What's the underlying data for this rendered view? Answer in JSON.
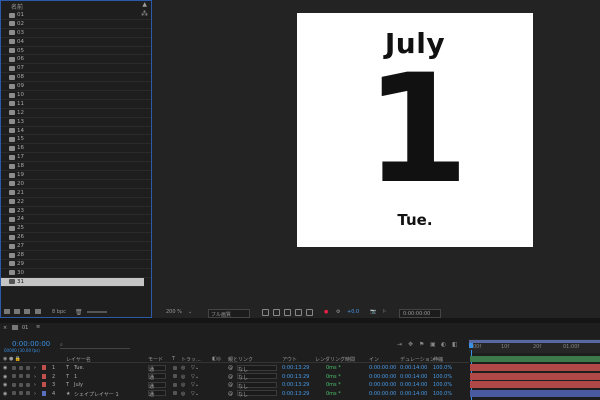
{
  "project": {
    "header_name": "名前",
    "sort_icon": "triangle-up-icon",
    "flow_icon": "flowchart-icon",
    "items": [
      "01",
      "02",
      "03",
      "04",
      "05",
      "06",
      "07",
      "08",
      "09",
      "10",
      "11",
      "12",
      "13",
      "14",
      "15",
      "16",
      "17",
      "18",
      "19",
      "20",
      "21",
      "22",
      "23",
      "24",
      "25",
      "26",
      "27",
      "28",
      "29",
      "30",
      "31"
    ],
    "selected_item": "31",
    "bpc_label": "8 bpc"
  },
  "composition": {
    "month": "July",
    "day": "1",
    "weekday": "Tue."
  },
  "viewer_bar": {
    "zoom": "200 %",
    "resolution": "フル画質",
    "exposure": "+0.0",
    "timecode": "0:00:00:00"
  },
  "timeline": {
    "tab_name": "01",
    "current_time": "0:00:00:00",
    "sub_time": "00000 (30.00 fps)",
    "search_placeholder": "",
    "ruler_ticks": [
      "00f",
      "10f",
      "20f",
      "01:00f"
    ],
    "columns": {
      "layer_name": "レイヤー名",
      "mode": "モード",
      "t": "T",
      "track": "トラッ...",
      "parent": "親とリンク",
      "out": "アウト",
      "render_time": "レンダリング時間",
      "in": "イン",
      "duration": "デュレーション",
      "stretch": "伸縮"
    },
    "layers": [
      {
        "num": "1",
        "type": "T",
        "name": "Tue.",
        "mode": "通",
        "parent": "なし",
        "out": "0:00:13:29",
        "render": "0ms *",
        "in": "0:00:00:00",
        "duration": "0:00:14:00",
        "stretch": "100.0%",
        "label_color": "#c0504d",
        "bar_color": "#b04848"
      },
      {
        "num": "2",
        "type": "T",
        "name": "1",
        "mode": "通",
        "parent": "なし",
        "out": "0:00:13:29",
        "render": "0ms *",
        "in": "0:00:00:00",
        "duration": "0:00:14:00",
        "stretch": "100.0%",
        "label_color": "#c0504d",
        "bar_color": "#b04848"
      },
      {
        "num": "3",
        "type": "T",
        "name": "July",
        "mode": "通",
        "parent": "なし",
        "out": "0:00:13:29",
        "render": "0ms *",
        "in": "0:00:00:00",
        "duration": "0:00:14:00",
        "stretch": "100.0%",
        "label_color": "#c0504d",
        "bar_color": "#b04848"
      },
      {
        "num": "4",
        "type": "★",
        "name": "シェイプレイヤー 1",
        "mode": "通",
        "parent": "なし",
        "out": "0:00:13:29",
        "render": "0ms *",
        "in": "0:00:00:00",
        "duration": "0:00:14:00",
        "stretch": "100.0%",
        "label_color": "#5a6fc0",
        "bar_color": "#4a5aa0"
      }
    ],
    "green_track_color": "#3d7a4a",
    "accent_color": "#3a8fe0"
  }
}
